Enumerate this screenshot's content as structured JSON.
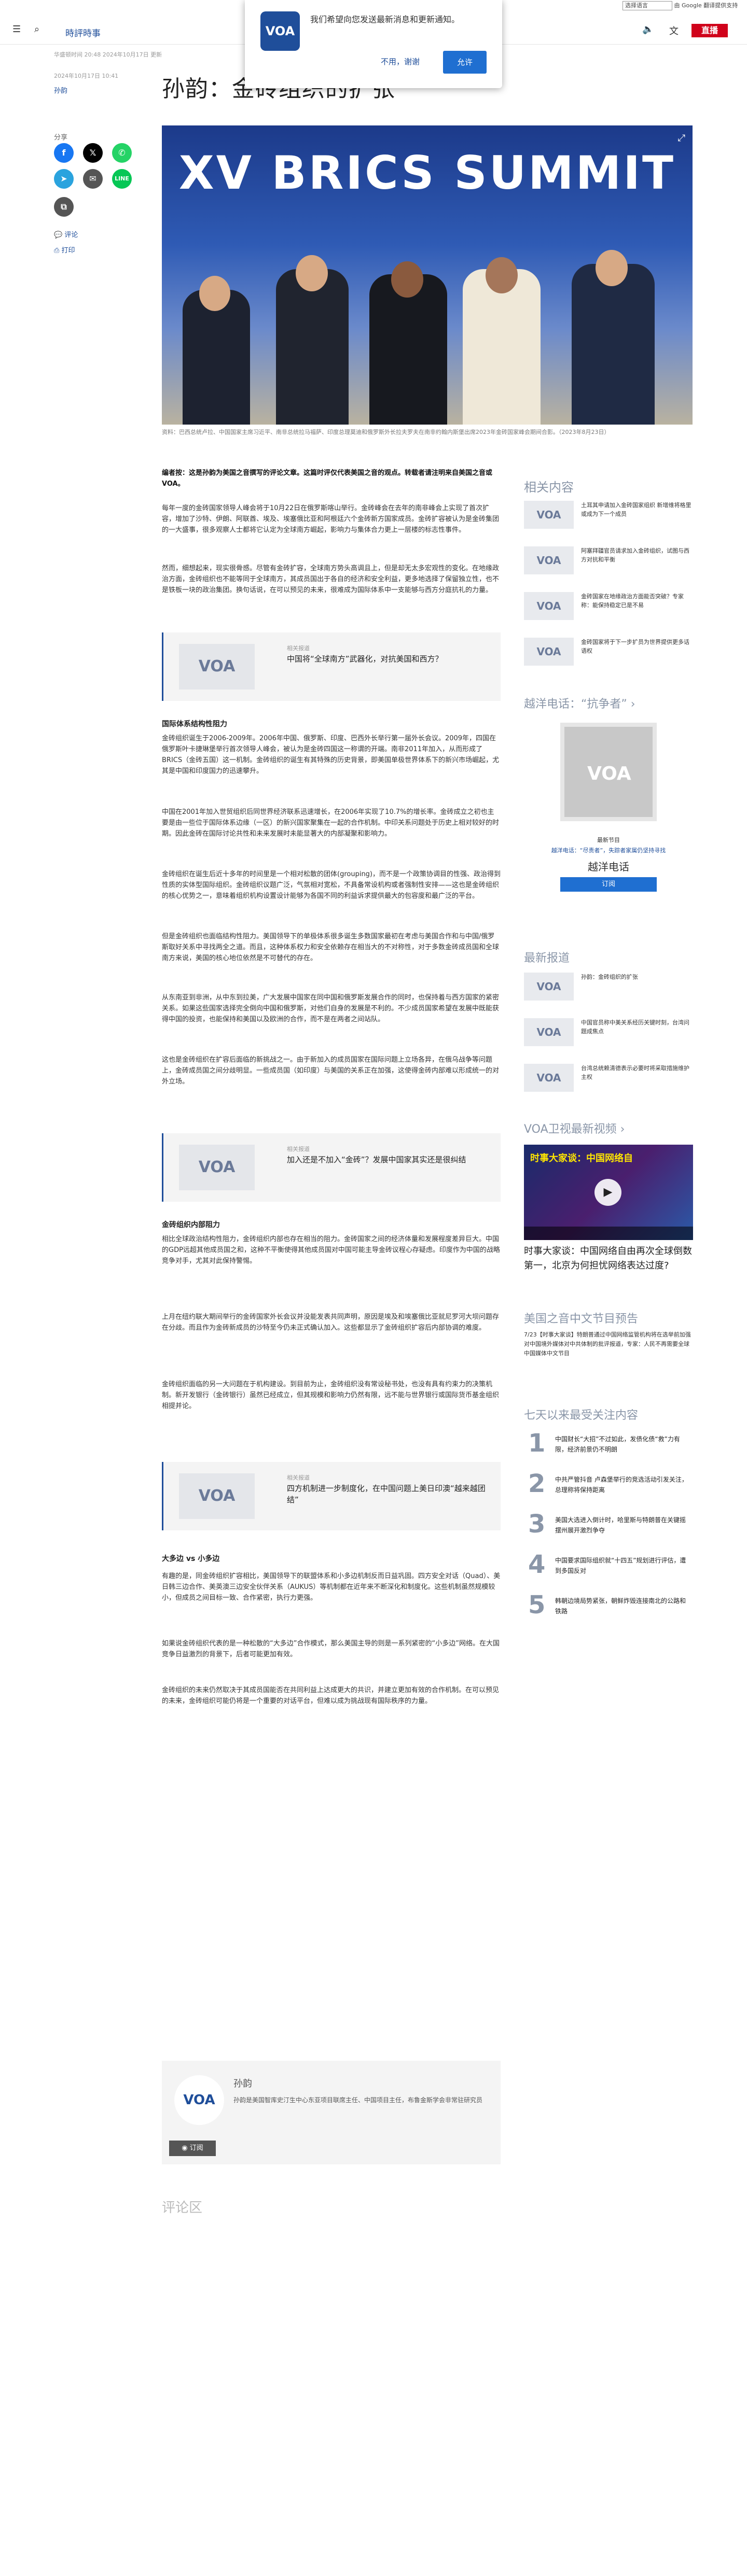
{
  "google_translate": {
    "select": "选择语言",
    "powered": "由 Google 翻译提供支持"
  },
  "header": {
    "section_link": "時評時事",
    "live_label": "直播"
  },
  "popup": {
    "message": "我们希望向您发送最新消息和更新通知。",
    "decline": "不用，谢谢",
    "accept": "允许",
    "logo": "VOA"
  },
  "article": {
    "meta": "华盛顿时间 20:48 2024年10月17日 更新",
    "date": "2024年10月17日 10:41",
    "author": "孙韵",
    "title": "孙韵：金砖组织的扩张",
    "image_banner": "XV BRICS SUMMIT",
    "caption": "资料：巴西总统卢拉、中国国家主席习近平、南非总统拉马福萨、印度总理莫迪和俄罗斯外长拉夫罗夫在南非约翰内斯堡出席2023年金砖国家峰会期间合影。（2023年8月23日）",
    "editor_note": "编者按：这是孙韵为美国之音撰写的评论文章。这篇时评仅代表美国之音的观点。转载者请注明来自美国之音或VOA。",
    "paragraphs": [
      "每年一度的金砖国家领导人峰会将于10月22日在俄罗斯喀山举行。金砖峰会在去年的南非峰会上实现了首次扩容，增加了沙特、伊朗、阿联酋、埃及、埃塞俄比亚和阿根廷六个金砖新方国家成员。金砖扩容被认为是金砖集团的一大盛事，很多观察人士都将它认定为全球南方崛起，影响力与集体合力更上一层楼的标志性事件。",
      "然而，细想起来，现实很骨感。尽管有金砖扩容，全球南方势头高调且上，但是却无太多宏观性的变化。在地缘政治方面，金砖组织也不能等同于全球南方，其成员国出于各自的经济和安全利益，更多地选择了保留独立性，也不是铁板一块的政治集团。换句话说，在可以预见的未来，很难成为国际体系中一支能够与西方分庭抗礼的力量。"
    ],
    "related_1": {
      "label": "相关报道",
      "title": "中国将“全球南方”武器化，对抗美国和西方？"
    },
    "h_origin": "国际体系结构性阻力",
    "paragraphs_2": [
      "金砖组织诞生于2006-2009年。2006年中国、俄罗斯、印度、巴西外长举行第一届外长会议。2009年，四国在俄罗斯叶卡捷琳堡举行首次领导人峰会，被认为是金砖四国这一称谓的开端。南非2011年加入，从而形成了BRICS（金砖五国）这一机制。金砖组织的诞生有其特殊的历史背景，即美国单极世界体系下的新兴市场崛起，尤其是中国和印度国力的迅速攀升。",
      "中国在2001年加入世贸组织后同世界经济联系迅速增长，在2006年实现了10.7%的增长率。金砖成立之初也主要是由一些位于国际体系边缘（一区）的新兴国家聚集在一起的合作机制。中印关系问题处于历史上相对较好的时期。因此金砖在国际讨论共性和未来发展时未能显著大的内部凝聚和影响力。",
      "金砖组织在诞生后近十多年的时间里是一个相对松散的团体(grouping)，而不是一个政策协调目的性强、政治得到性质的实体型国际组织。金砖组织议题广泛，气氛相对宽松，不具备常设机构或者强制性安排——这也是金砖组织的核心优势之一，意味着组织机构设置设计能够为各国不同的利益诉求提供最大的包容度和最广泛的平台。",
      "但是金砖组织也面临结构性阻力。美国领导下的单极体系很多诞生多数国家最初在考虑与美国合作和与中国/俄罗斯取好关系中寻找两全之道。而且，这种体系权力和安全依赖存在相当大的不对称性，对于多数金砖成员国和全球南方来说，美国的核心地位依然是不可替代的存在。",
      "从东南亚到非洲，从中东到拉美，广大发展中国家在同中国和俄罗斯发展合作的同时，也保持着与西方国家的紧密关系。如果这些国家选择完全倒向中国和俄罗斯，对他们自身的发展是不利的。不少成员国家希望在发展中既能获得中国的投资，也能保持和美国以及欧洲的合作，而不是在两者之间站队。",
      "这也是金砖组织在扩容后面临的新挑战之一。由于新加入的成员国家在国际问题上立场各异，在俄乌战争等问题上，金砖成员国之间分歧明显。一些成员国（如印度）与美国的关系正在加强，这使得金砖内部难以形成统一的对外立场。"
    ],
    "related_2": {
      "label": "相关报道",
      "title": "加入还是不加入“金砖”？发展中国家其实还是很纠结"
    },
    "h_expand": "金砖组织内部阻力",
    "paragraphs_3": [
      "相比全球政治结构性阻力，金砖组织内部也存在相当的阻力。金砖国家之间的经济体量和发展程度差异巨大。中国的GDP远超其他成员国之和，这种不平衡使得其他成员国对中国可能主导金砖议程心存疑虑。印度作为中国的战略竞争对手，尤其对此保持警惕。",
      "上月在纽约联大期间举行的金砖国家外长会议并没能发表共同声明，原因是埃及和埃塞俄比亚就尼罗河大坝问题存在分歧。而且作为金砖新成员的沙特至今仍未正式确认加入。这些都显示了金砖组织扩容后内部协调的难度。",
      "金砖组织面临的另一大问题在于机构建设。到目前为止，金砖组织没有常设秘书处，也没有具有约束力的决策机制。新开发银行（金砖银行）虽然已经成立，但其规模和影响力仍然有限，远不能与世界银行或国际货币基金组织相提并论。"
    ],
    "related_3": {
      "label": "相关报道",
      "title": "四方机制进一步制度化，在中国问题上美日印澳“越来越团结”"
    },
    "h_big": "大多边 vs 小多边",
    "paragraphs_4": [
      "有趣的是，同金砖组织扩容相比，美国领导下的联盟体系和小多边机制反而日益巩固。四方安全对话（Quad）、美日韩三边合作、美英澳三边安全伙伴关系（AUKUS）等机制都在近年来不断深化和制度化。这些机制虽然规模较小，但成员之间目标一致、合作紧密，执行力更强。",
      "如果说金砖组织代表的是一种松散的“大多边”合作模式，那么美国主导的则是一系列紧密的“小多边”网络。在大国竞争日益激烈的背景下，后者可能更加有效。",
      "金砖组织的未来仍然取决于其成员国能否在共同利益上达成更大的共识，并建立更加有效的合作机制。在可以预见的未来，金砖组织可能仍将是一个重要的对话平台，但难以成为挑战现有国际秩序的力量。"
    ],
    "author_box": {
      "name": "孙韵",
      "desc": "孙韵是美国智库史汀生中心东亚项目联席主任、中国项目主任，布鲁金斯学会非常驻研究员",
      "subscribe": "订阅"
    },
    "comments": "评论区"
  },
  "share": {
    "label": "分享",
    "comment": "评论",
    "print": "打印"
  },
  "rail": {
    "related_title": "相关内容",
    "related": [
      "土耳其申请加入金砖国家组织 新增维将格里或成为下一个成员",
      "阿塞拜疆官员请求加入金砖组织，试图与西方对抗和平衡",
      "金砖国家在地缘政治方面能否突破？专家称：能保持稳定已是不易",
      "金砖国家将于下一步扩员为世界提供更多话语权"
    ],
    "hotline_title": "越洋电话：“抗争者”",
    "hotline_img": "VOA",
    "hotline_label": "最新节目",
    "hotline_desc": "越洋电话：“尽责者”，失踪者家属仍坚持寻找",
    "hotline_name": "越洋电话",
    "hotline_sub": "订阅",
    "latest_title": "最新报道",
    "latest": [
      "孙韵：金砖组织的扩张",
      "中国官员称中美关系经历关键时刻，台湾问题成焦点",
      "台湾总统赖清德表示必要时将采取措施维护主权"
    ],
    "video_title": "VOA卫视最新视频",
    "video_overlay": "时事大家谈：中国网络自",
    "video_caption": "时事大家谈：中国网络自由再次全球倒数第一，北京为何担忧网络表达过度?",
    "podcast_title": "美国之音中文节目预告",
    "podcast_desc": "7/23【时事大家谈】特朗普通过中国网络监管机构将在选举前加强对中国境外媒体对中共体制的批评报道，专家：人民不再需要全球中国媒体中文节目",
    "popular_title": "七天以来最受关注内容",
    "popular": [
      "中国财长“大招”不过如此，发债化债“救”力有限，经济前景仍不明朗",
      "中共严管抖音 卢森堡举行的竞选活动引发关注，总理称将保持距离",
      "美国大选进入倒计时，哈里斯与特朗普在关键摇摆州展开激烈争夺",
      "中国要求国际组织就“十四五”规划进行评估，遭到多国反对",
      "韩朝边境局势紧张，朝鲜炸毁连接南北的公路和铁路"
    ]
  },
  "colors": {
    "brand": "#1f4e9a",
    "live": "#d0021b",
    "facebook": "#1877f2",
    "x": "#000000",
    "whatsapp": "#25d366",
    "telegram": "#2aa3de",
    "line": "#06c755"
  }
}
